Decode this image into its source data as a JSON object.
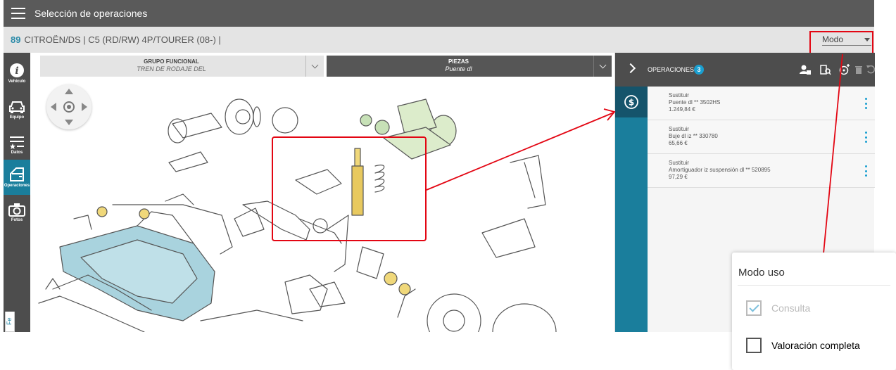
{
  "header": {
    "title": "Selección de operaciones"
  },
  "vehicle": {
    "code": "89",
    "description": "CITROËN/DS | C5 (RD/RW) 4P/TOURER (08-) |"
  },
  "mode_select": {
    "label": "Modo"
  },
  "sidebar": {
    "items": [
      {
        "label": "Vehículo",
        "icon": "info-icon"
      },
      {
        "label": "Equipo",
        "icon": "car-icon"
      },
      {
        "label": "Datos",
        "icon": "list-star-icon"
      },
      {
        "label": "Operaciones",
        "icon": "car-door-icon",
        "active": true
      },
      {
        "label": "Fotos",
        "icon": "camera-icon"
      }
    ],
    "feedback_tab": "Fe"
  },
  "selectors": {
    "grupo": {
      "title": "GRUPO FUNCIONAL",
      "value": "TREN DE RODAJE DEL"
    },
    "piezas": {
      "title": "PIEZAS",
      "value": "Puente dl"
    }
  },
  "operations_panel": {
    "label": "OPERACIONES",
    "count": "3",
    "items": [
      {
        "action": "Sustituir",
        "part": "Puente dl ** 3502HS",
        "price": "1.249,84 €"
      },
      {
        "action": "Sustituir",
        "part": "Buje dl iz ** 330780",
        "price": "65,66 €"
      },
      {
        "action": "Sustituir",
        "part": "Amortiguador iz suspensión dl ** 520895",
        "price": "97,29 €"
      }
    ]
  },
  "mode_popup": {
    "title": "Modo uso",
    "options": [
      {
        "label": "Consulta",
        "checked": true,
        "disabled": true
      },
      {
        "label": "Valoración completa",
        "checked": false,
        "disabled": false
      }
    ]
  },
  "colors": {
    "accent": "#1a7e9c",
    "dark": "#4d4d4d",
    "annotation": "#e30613",
    "part_highlight": "#a9d3de"
  }
}
